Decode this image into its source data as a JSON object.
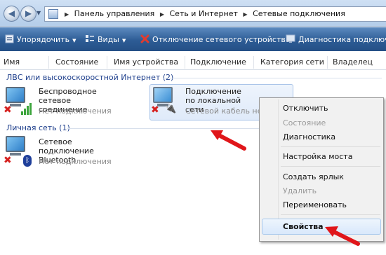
{
  "addressbar": {
    "back_icon": "back-arrow-icon",
    "forward_icon": "forward-arrow-icon",
    "crumbs": [
      "Панель управления",
      "Сеть и Интернет",
      "Сетевые подключения"
    ]
  },
  "toolbar": {
    "organize": "Упорядочить",
    "views": "Виды",
    "disable_device": "Отключение сетевого устройства",
    "diagnostics": "Диагностика подключ"
  },
  "columns": [
    "Имя",
    "Состояние",
    "Имя устройства",
    "Подключение",
    "Категория сети",
    "Владелец"
  ],
  "groups": {
    "lan": {
      "title": "ЛВС или высокоскоростной Интернет (2)",
      "items": [
        {
          "name_line1": "Беспроводное сетевое",
          "name_line2": "соединение",
          "status": "Нет подключения"
        },
        {
          "name_line1": "Подключение по локальной",
          "name_line2": "сети",
          "status": "Сетевой кабель не п"
        }
      ]
    },
    "personal": {
      "title": "Личная сеть (1)",
      "items": [
        {
          "name_line1": "Сетевое подключение",
          "name_line2": "Bluetooth",
          "status": "Нет подключения"
        }
      ]
    }
  },
  "context_menu": {
    "items": [
      {
        "label": "Отключить",
        "enabled": true
      },
      {
        "label": "Состояние",
        "enabled": false
      },
      {
        "label": "Диагностика",
        "enabled": true
      },
      {
        "label": "Настройка моста",
        "enabled": true
      },
      {
        "label": "Создать ярлык",
        "enabled": true
      },
      {
        "label": "Удалить",
        "enabled": false
      },
      {
        "label": "Переименовать",
        "enabled": true
      },
      {
        "label": "Свойства",
        "enabled": true,
        "default": true,
        "highlighted": true
      }
    ]
  },
  "colors": {
    "arrow": "#e0161a",
    "group_text": "#1e3f8c",
    "toolbar": "#2d5c95"
  }
}
